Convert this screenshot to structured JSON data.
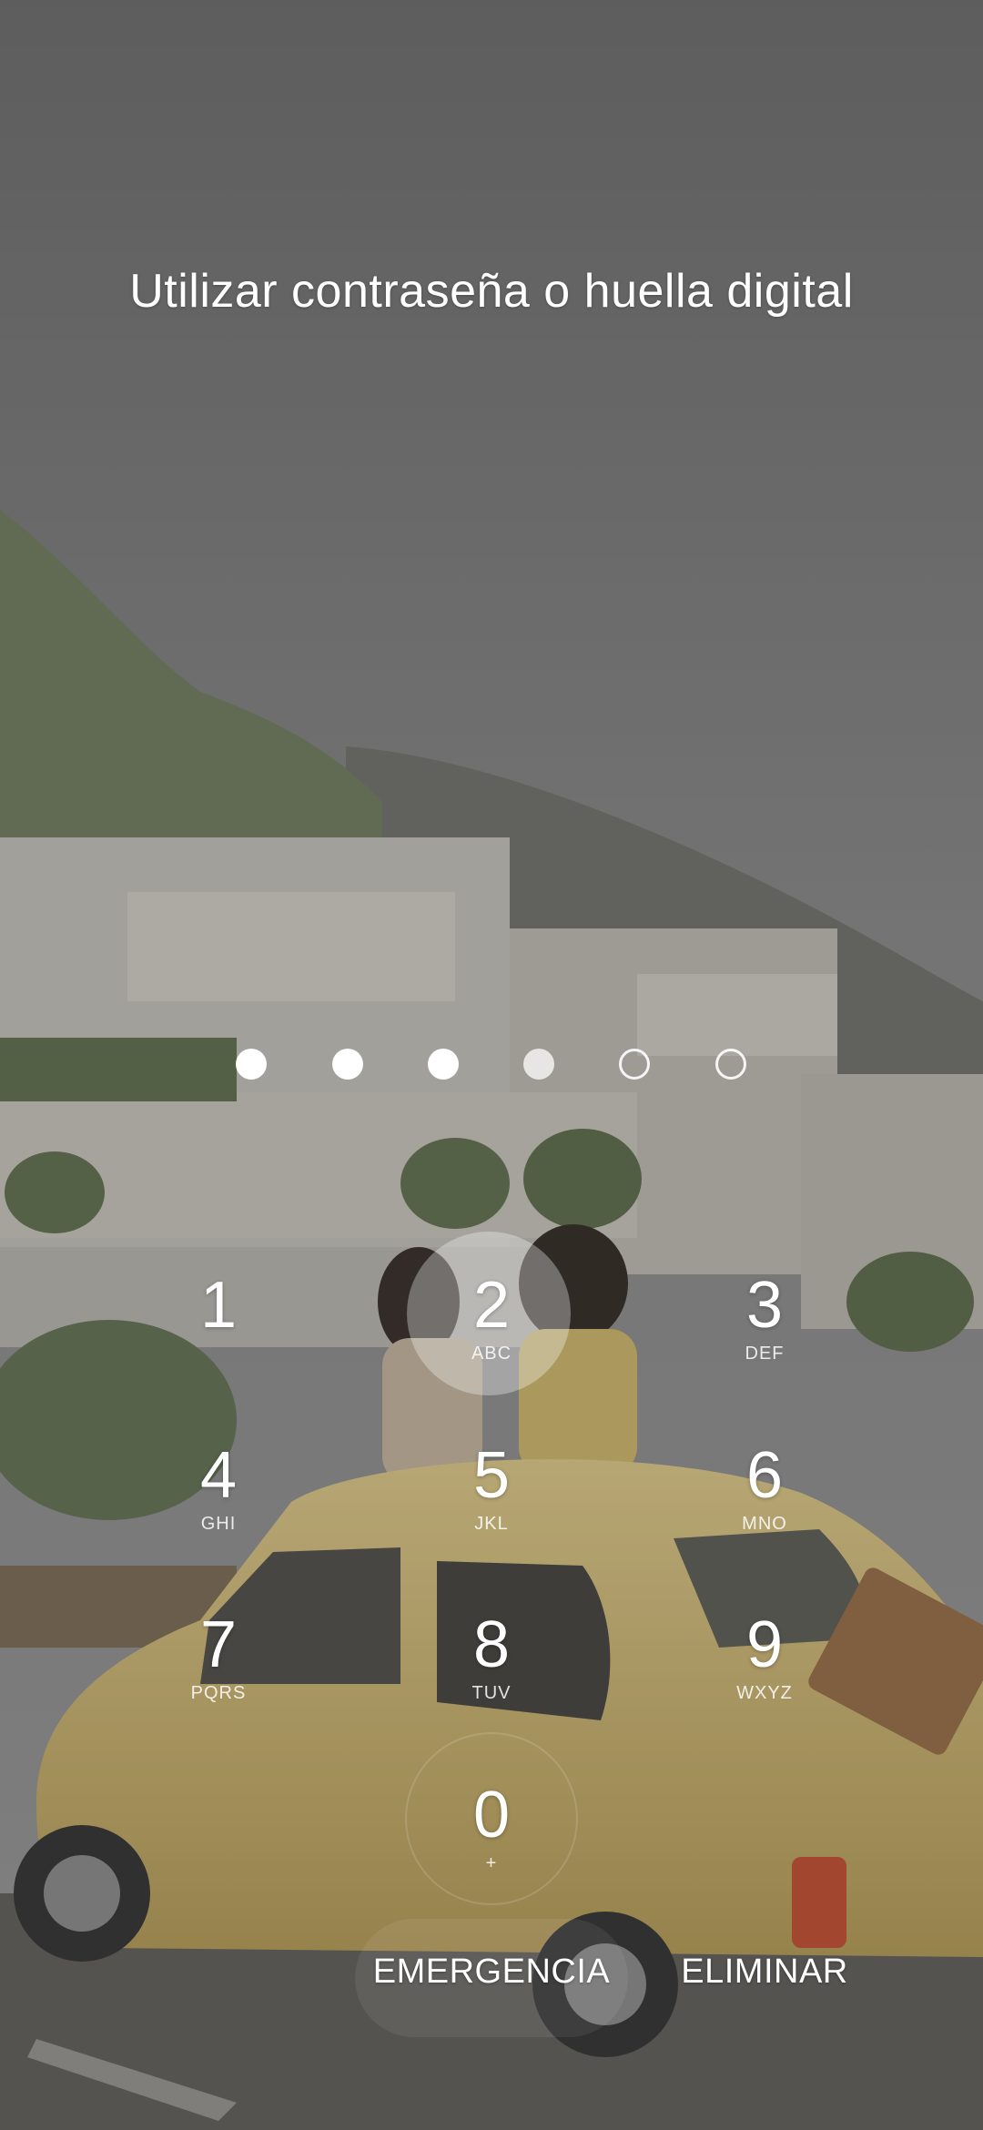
{
  "lockscreen": {
    "prompt": "Utilizar contraseña o huella digital",
    "pin": {
      "entered_count": 4,
      "total_slots": 6
    },
    "keypad": [
      {
        "digit": "1",
        "letters": ""
      },
      {
        "digit": "2",
        "letters": "ABC"
      },
      {
        "digit": "3",
        "letters": "DEF"
      },
      {
        "digit": "4",
        "letters": "GHI"
      },
      {
        "digit": "5",
        "letters": "JKL"
      },
      {
        "digit": "6",
        "letters": "MNO"
      },
      {
        "digit": "7",
        "letters": "PQRS"
      },
      {
        "digit": "8",
        "letters": "TUV"
      },
      {
        "digit": "9",
        "letters": "WXYZ"
      },
      {
        "digit": "0",
        "letters": "+"
      }
    ],
    "actions": {
      "emergency": "EMERGENCIA",
      "delete": "ELIMINAR"
    }
  },
  "colors": {
    "text": "#ffffff",
    "sky": "#7a7a7a",
    "car": "#d9c27a"
  }
}
